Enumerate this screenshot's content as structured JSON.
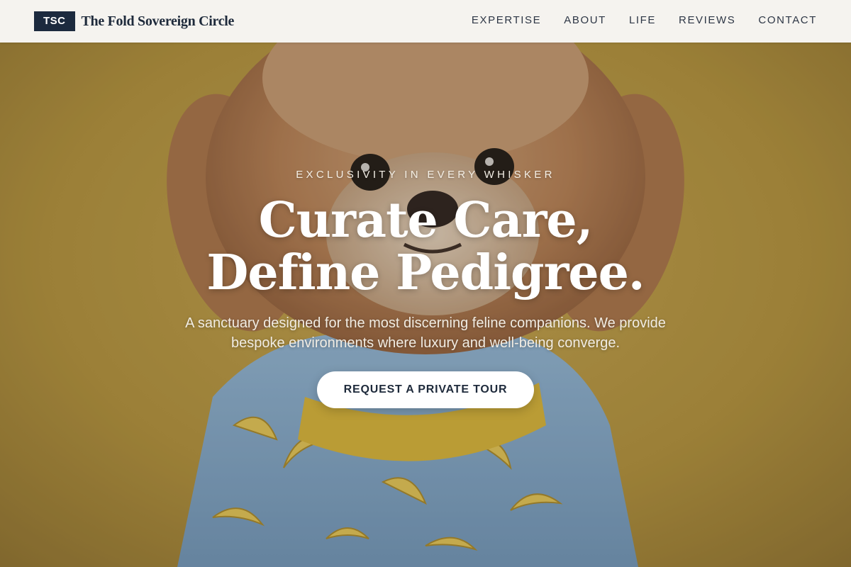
{
  "header": {
    "brand_badge": "TSC",
    "brand_name": "The Fold Sovereign Circle",
    "nav": [
      {
        "label": "EXPERTISE"
      },
      {
        "label": "ABOUT"
      },
      {
        "label": "LIFE"
      },
      {
        "label": "REVIEWS"
      },
      {
        "label": "CONTACT"
      }
    ]
  },
  "hero": {
    "eyebrow": "EXCLUSIVITY IN EVERY WHISKER",
    "headline_line1": "Curate Care,",
    "headline_line2": "Define Pedigree.",
    "subtitle": "A sanctuary designed for the most discerning feline companions. We provide bespoke environments where luxury and well-being converge.",
    "cta_label": "REQUEST A PRIVATE TOUR"
  },
  "colors": {
    "brand_navy": "#1c2a3e",
    "header_bg": "#f5f3ef",
    "hero_bg": "#b39447",
    "cta_bg": "#ffffff"
  }
}
